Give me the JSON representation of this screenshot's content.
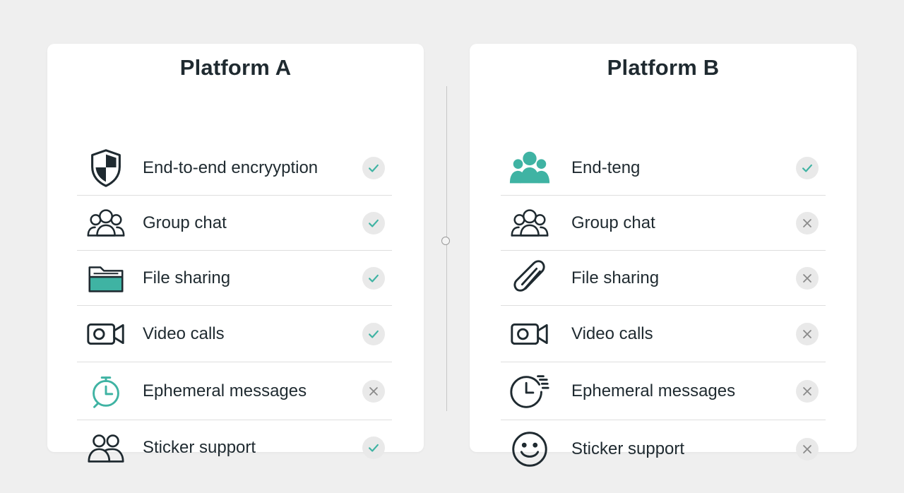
{
  "colors": {
    "accent": "#3fb3a3",
    "ink": "#1f2a30",
    "cross": "#8a8a8a",
    "background": "#efefef"
  },
  "platform_a": {
    "title": "Platform A",
    "features": [
      {
        "label": "End-to-end encryyption",
        "icon": "shield-icon",
        "supported": true
      },
      {
        "label": "Group chat",
        "icon": "group-icon",
        "supported": true
      },
      {
        "label": "File sharing",
        "icon": "folder-icon",
        "supported": true
      },
      {
        "label": "Video calls",
        "icon": "video-camera-icon",
        "supported": true
      },
      {
        "label": "Ephemeral messages",
        "icon": "stopwatch-icon",
        "supported": false
      },
      {
        "label": "Sticker support",
        "icon": "two-people-icon",
        "supported": true
      }
    ]
  },
  "platform_b": {
    "title": "Platform B",
    "features": [
      {
        "label": "End-teng",
        "icon": "people-filled-icon",
        "supported": true
      },
      {
        "label": "Group chat",
        "icon": "group-icon",
        "supported": false
      },
      {
        "label": "File sharing",
        "icon": "paperclip-icon",
        "supported": false
      },
      {
        "label": "Video calls",
        "icon": "video-camera-icon",
        "supported": false
      },
      {
        "label": "Ephemeral messages",
        "icon": "fast-clock-icon",
        "supported": false
      },
      {
        "label": "Sticker support",
        "icon": "smiley-icon",
        "supported": false
      }
    ]
  }
}
